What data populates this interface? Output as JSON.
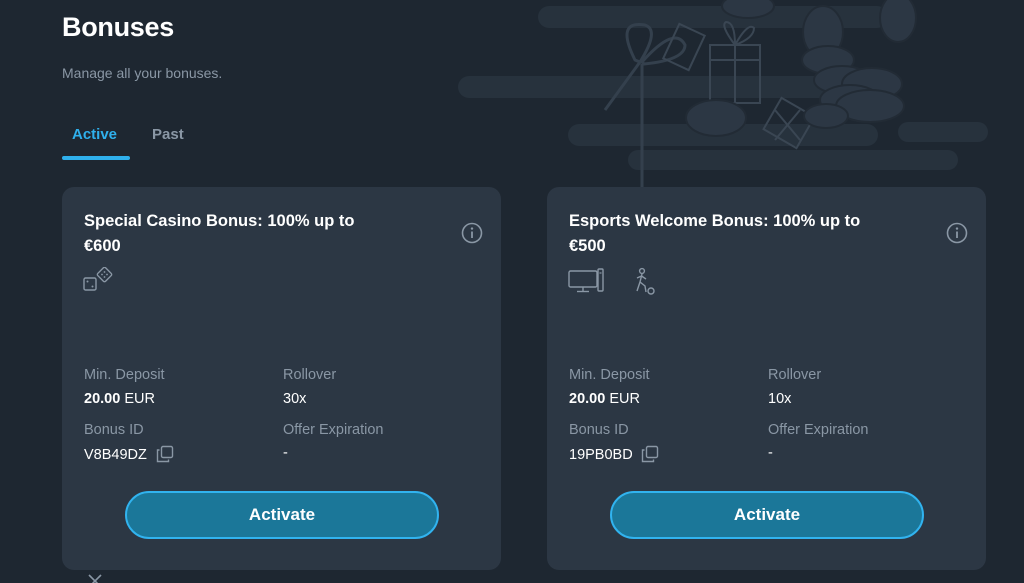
{
  "header": {
    "title": "Bonuses",
    "subtitle": "Manage all your bonuses."
  },
  "tabs": [
    {
      "label": "Active",
      "selected": true
    },
    {
      "label": "Past",
      "selected": false
    }
  ],
  "labels": {
    "min_deposit": "Min. Deposit",
    "rollover": "Rollover",
    "bonus_id": "Bonus ID",
    "offer_expiration": "Offer Expiration",
    "activate": "Activate"
  },
  "cards": [
    {
      "title_line1": "Special Casino Bonus: 100% up to",
      "title_line2": "€600",
      "category_icons": [
        "casino-dice-icon"
      ],
      "min_deposit_amount": "20.00",
      "min_deposit_currency": "EUR",
      "rollover": "30x",
      "bonus_id": "V8B49DZ",
      "offer_expiration": "-"
    },
    {
      "title_line1": "Esports Welcome Bonus: 100% up to",
      "title_line2": "€500",
      "category_icons": [
        "esports-monitor-icon",
        "sports-player-icon"
      ],
      "min_deposit_amount": "20.00",
      "min_deposit_currency": "EUR",
      "rollover": "10x",
      "bonus_id": "19PB0BD",
      "offer_expiration": "-"
    }
  ],
  "colors": {
    "background": "#1e2731",
    "card": "#2c3744",
    "accent": "#2fb0ec",
    "button_fill": "#1b7799",
    "muted_text": "#8a97a5"
  }
}
